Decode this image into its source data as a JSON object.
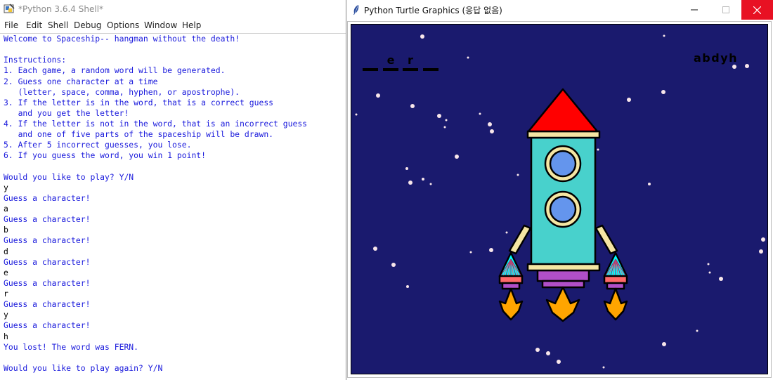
{
  "shell": {
    "title": "*Python 3.6.4 Shell*",
    "menu": [
      "File",
      "Edit",
      "Shell",
      "Debug",
      "Options",
      "Window",
      "Help"
    ],
    "lines": [
      {
        "t": "out",
        "s": "Welcome to Spaceship-- hangman without the death!"
      },
      {
        "t": "out",
        "s": ""
      },
      {
        "t": "out",
        "s": "Instructions:"
      },
      {
        "t": "out",
        "s": "1. Each game, a random word will be generated."
      },
      {
        "t": "out",
        "s": "2. Guess one character at a time"
      },
      {
        "t": "out",
        "s": "   (letter, space, comma, hyphen, or apostrophe)."
      },
      {
        "t": "out",
        "s": "3. If the letter is in the word, that is a correct guess"
      },
      {
        "t": "out",
        "s": "   and you get the letter!"
      },
      {
        "t": "out",
        "s": "4. If the letter is not in the word, that is an incorrect guess"
      },
      {
        "t": "out",
        "s": "   and one of five parts of the spaceship will be drawn."
      },
      {
        "t": "out",
        "s": "5. After 5 incorrect guesses, you lose."
      },
      {
        "t": "out",
        "s": "6. If you guess the word, you win 1 point!"
      },
      {
        "t": "out",
        "s": ""
      },
      {
        "t": "out",
        "s": "Would you like to play? Y/N"
      },
      {
        "t": "inp",
        "s": "y"
      },
      {
        "t": "out",
        "s": "Guess a character!"
      },
      {
        "t": "inp",
        "s": "a"
      },
      {
        "t": "out",
        "s": "Guess a character!"
      },
      {
        "t": "inp",
        "s": "b"
      },
      {
        "t": "out",
        "s": "Guess a character!"
      },
      {
        "t": "inp",
        "s": "d"
      },
      {
        "t": "out",
        "s": "Guess a character!"
      },
      {
        "t": "inp",
        "s": "e"
      },
      {
        "t": "out",
        "s": "Guess a character!"
      },
      {
        "t": "inp",
        "s": "r"
      },
      {
        "t": "out",
        "s": "Guess a character!"
      },
      {
        "t": "inp",
        "s": "y"
      },
      {
        "t": "out",
        "s": "Guess a character!"
      },
      {
        "t": "inp",
        "s": "h"
      },
      {
        "t": "out",
        "s": "You lost! The word was FERN."
      },
      {
        "t": "out",
        "s": ""
      },
      {
        "t": "out",
        "s": "Would you like to play again? Y/N"
      }
    ]
  },
  "turtle": {
    "title": "Python Turtle Graphics (응답 없음)",
    "word_slots": [
      "",
      "e",
      "r",
      ""
    ],
    "wrong_guesses": "abdyh",
    "colors": {
      "sky": "#1a1a6e",
      "star": "#f8e6ea",
      "nose": "#ff0000",
      "body": "#48d1cc",
      "trim": "#f5e6a3",
      "window": "#6495ed",
      "exhaust": "#b04fc8",
      "flame": "#ffa500",
      "booster_tip": "#00ffff",
      "booster_body": "#ff6a6a",
      "close_button": "#e81123"
    }
  }
}
